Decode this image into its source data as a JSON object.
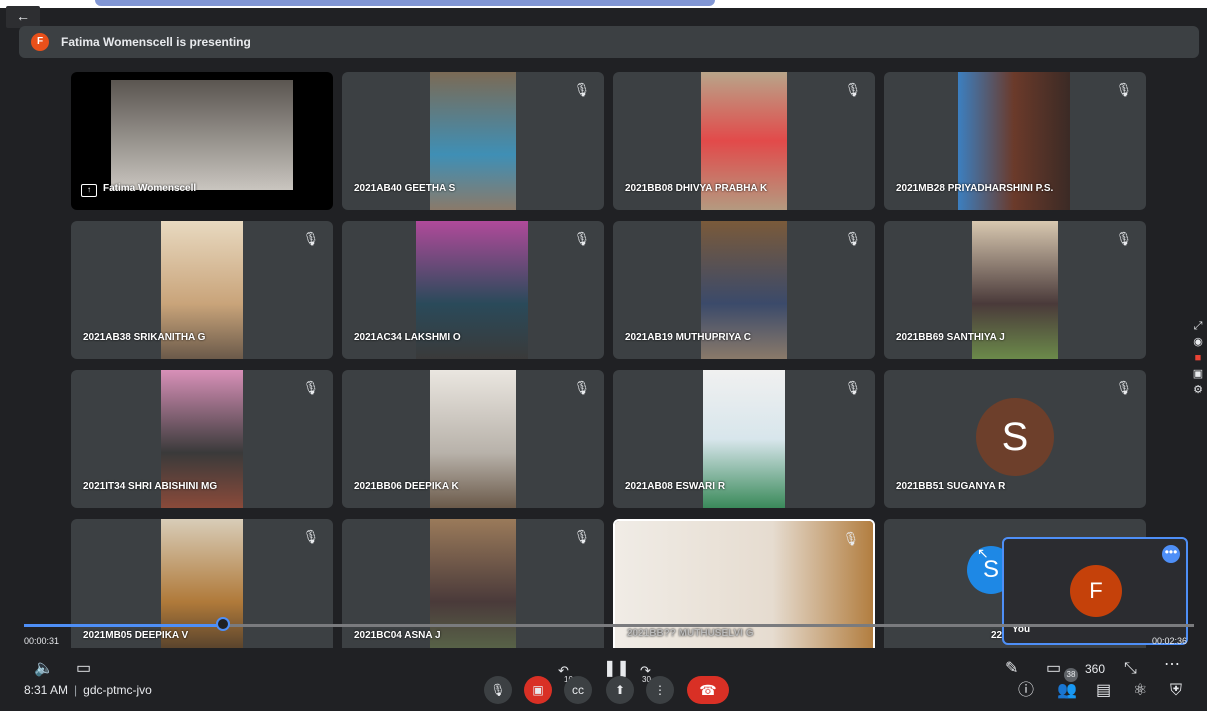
{
  "back_label": "←",
  "banner": {
    "avatar_letter": "F",
    "text": "Fatima Womenscell is presenting"
  },
  "tiles": [
    {
      "name": "Fatima Womenscell"
    },
    {
      "name": "2021AB40 GEETHA S"
    },
    {
      "name": "2021BB08 DHIVYA PRABHA K"
    },
    {
      "name": "2021MB28 PRIYADHARSHINI P.S."
    },
    {
      "name": "2021AB38 SRIKANITHA G"
    },
    {
      "name": "2021AC34 LAKSHMI O"
    },
    {
      "name": "2021AB19 MUTHUPRIYA C"
    },
    {
      "name": "2021BB69 SANTHIYA J"
    },
    {
      "name": "2021IT34 SHRI ABISHINI MG"
    },
    {
      "name": "2021BB06 DEEPIKA K"
    },
    {
      "name": "2021AB08 ESWARI R"
    },
    {
      "name": "2021BB51 SUGANYA R",
      "avatar": "S"
    },
    {
      "name": "2021MB05 DEEPIKA V"
    },
    {
      "name": "2021BC04 ASNA J"
    },
    {
      "name": "2021BB?? MUTHUSELVI G"
    },
    {
      "name": "22"
    }
  ],
  "extra_avatar": "S",
  "self_view": {
    "letter": "F",
    "label": "You",
    "more": "•••"
  },
  "playback": {
    "elapsed": "00:00:31",
    "total": "00:02:36",
    "progress": 0.17,
    "rewind": "10",
    "forward": "30"
  },
  "meeting": {
    "time": "8:31 AM",
    "separator": "|",
    "code": "gdc-ptmc-jvo"
  },
  "participant_count": "38",
  "colors": {
    "accent": "#4e8ff7",
    "end_call": "#d93025"
  }
}
